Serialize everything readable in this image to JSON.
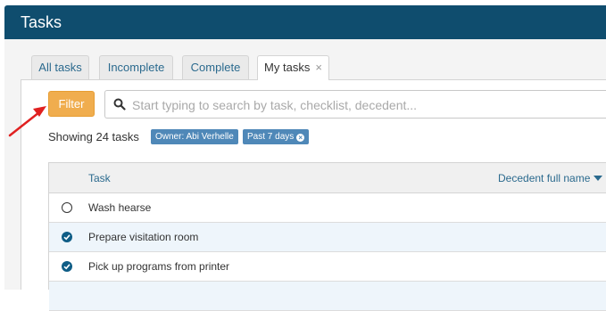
{
  "header": {
    "title": "Tasks"
  },
  "tabs": [
    {
      "label": "All tasks"
    },
    {
      "label": "Incomplete"
    },
    {
      "label": "Complete"
    },
    {
      "label": "My tasks",
      "close": "×"
    }
  ],
  "toolbar": {
    "filter_label": "Filter"
  },
  "search": {
    "placeholder": "Start typing to search by task, checklist, decedent...",
    "value": ""
  },
  "summary": {
    "showing_text": "Showing 24 tasks"
  },
  "chips": [
    {
      "label": "Owner: Abi Verhelle"
    },
    {
      "label": "Past 7 days",
      "remove": "×"
    }
  ],
  "table": {
    "columns": {
      "task": "Task",
      "decedent": "Decedent full name"
    },
    "rows": [
      {
        "task": "Wash hearse",
        "complete": false
      },
      {
        "task": "Prepare visitation room",
        "complete": true
      },
      {
        "task": "Pick up programs from printer",
        "complete": true
      }
    ]
  },
  "colors": {
    "header_bg": "#0f4d6e",
    "filter_btn": "#f0ad4e",
    "chip_bg": "#4f88b8",
    "link": "#2b6a8e",
    "annotation_arrow": "#e02020"
  }
}
